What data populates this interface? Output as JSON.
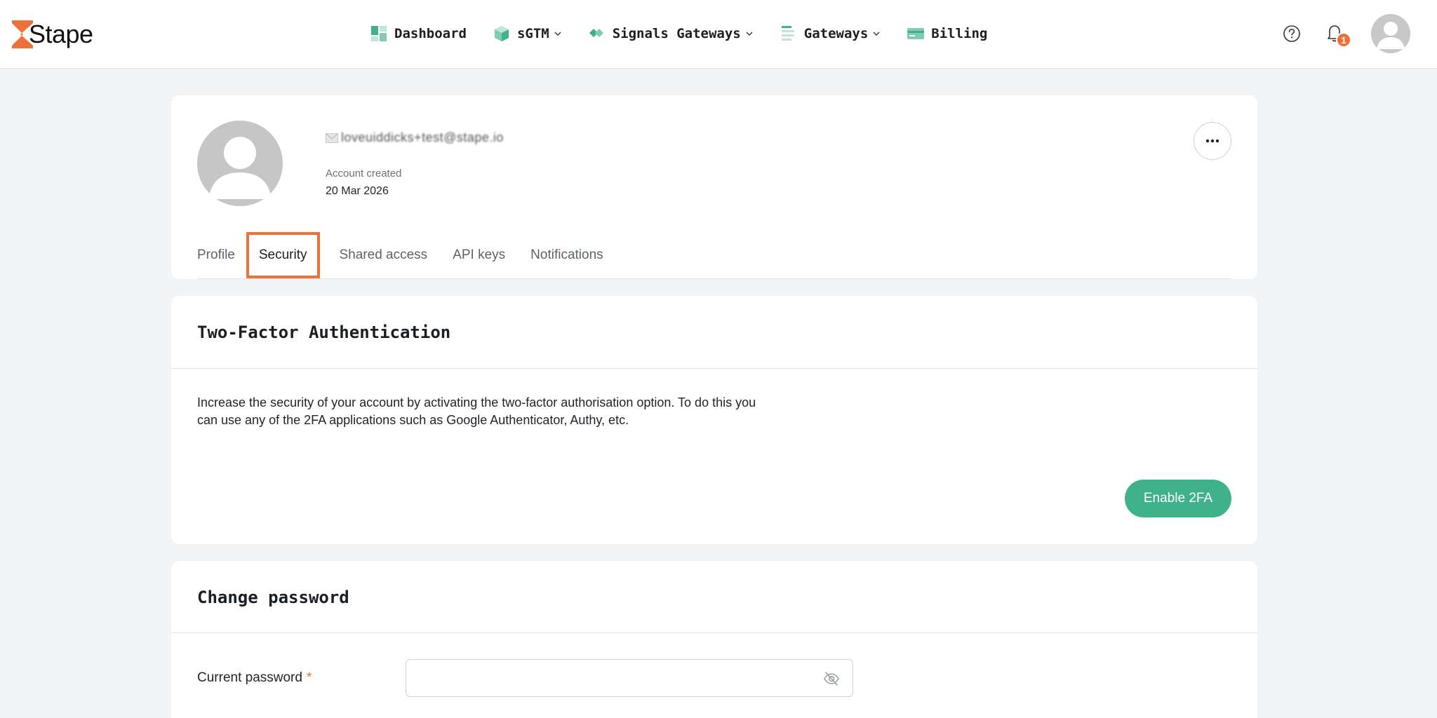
{
  "brand": {
    "name": "Stape",
    "accent": "#f0703a",
    "green": "#3fb28c"
  },
  "nav": {
    "items": [
      {
        "label": "Dashboard",
        "icon": "dashboard-icon",
        "has_dropdown": false
      },
      {
        "label": "sGTM",
        "icon": "cube-icon",
        "has_dropdown": true
      },
      {
        "label": "Signals Gateways",
        "icon": "signals-icon",
        "has_dropdown": true
      },
      {
        "label": "Gateways",
        "icon": "gateways-icon",
        "has_dropdown": true
      },
      {
        "label": "Billing",
        "icon": "credit-card-icon",
        "has_dropdown": false
      }
    ]
  },
  "header_right": {
    "notification_count": "1"
  },
  "profile": {
    "email": "loveuiddicks+test@stape.io",
    "created_label": "Account created",
    "created_date": "20 Mar 2026"
  },
  "tabs": [
    {
      "label": "Profile",
      "active": false
    },
    {
      "label": "Security",
      "active": true
    },
    {
      "label": "Shared access",
      "active": false
    },
    {
      "label": "API keys",
      "active": false
    },
    {
      "label": "Notifications",
      "active": false
    }
  ],
  "two_factor": {
    "title": "Two-Factor Authentication",
    "description": "Increase the security of your account by activating the two-factor authorisation option. To do this you can use any of the 2FA applications such as Google Authenticator, Authy, etc.",
    "button_label": "Enable 2FA"
  },
  "change_password": {
    "title": "Change password",
    "current_label": "Current password",
    "required_mark": "*",
    "current_value": ""
  }
}
